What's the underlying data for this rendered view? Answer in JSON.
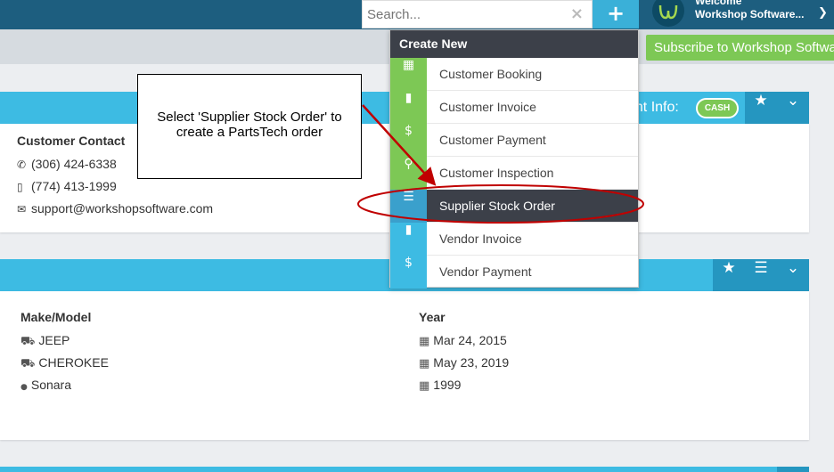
{
  "header": {
    "search_placeholder": "Search...",
    "clear_icon": "×",
    "add_icon": "+",
    "user_top": "Welcome",
    "user_name": "Workshop Software...",
    "info_icon": "❯"
  },
  "subscribe": {
    "label": "Subscribe to Workshop Software"
  },
  "create_menu": {
    "title": "Create New",
    "items": [
      {
        "label": "Customer Booking",
        "icon": "calendar-icon",
        "glyph": "▦",
        "color": "#7dc855"
      },
      {
        "label": "Customer Invoice",
        "icon": "document-icon",
        "glyph": "▮",
        "color": "#7dc855"
      },
      {
        "label": "Customer Payment",
        "icon": "dollar-icon",
        "glyph": "$",
        "color": "#7dc855"
      },
      {
        "label": "Customer Inspection",
        "icon": "search-icon",
        "glyph": "⚲",
        "color": "#7dc855"
      },
      {
        "label": "Supplier Stock Order",
        "icon": "list-icon",
        "glyph": "☰",
        "color": "#3aa0cc"
      },
      {
        "label": "Vendor Invoice",
        "icon": "document-icon",
        "glyph": "▮",
        "color": "#3dbbe3"
      },
      {
        "label": "Vendor Payment",
        "icon": "dollar-icon",
        "glyph": "$",
        "color": "#3dbbe3"
      }
    ]
  },
  "annotation": {
    "line1": "Select 'Supplier Stock Order' to",
    "line2": "create a PartsTech order"
  },
  "customer_card": {
    "account_label": "unt Info:",
    "cash_badge": "CASH",
    "star_icon": "★",
    "chevron_icon": "⌄",
    "contact_title": "Customer Contact",
    "phone": "(306) 424-6338",
    "mobile": "(774) 413-1999",
    "email": "support@workshopsoftware.com",
    "phone_glyph": "✆",
    "mobile_glyph": "▯",
    "email_glyph": "✉"
  },
  "vehicle_card": {
    "star_icon": "★",
    "list_icon": "☰",
    "chevron_icon": "⌄",
    "make_title": "Make/Model",
    "year_title": "Year",
    "make_lines": [
      "JEEP",
      "CHEROKEE",
      "Sonara"
    ],
    "year_lines": [
      "Mar 24, 2015",
      "May 23, 2019",
      "1999"
    ],
    "car_glyph": "⛟",
    "drop_glyph": "●",
    "cal_glyph": "▦"
  },
  "colors": {
    "header_dark": "#1d5e7f",
    "accent_blue": "#3dbbe3",
    "accent_green": "#7dc855",
    "menu_dark": "#3c4049",
    "annotation_red": "#c00000"
  }
}
